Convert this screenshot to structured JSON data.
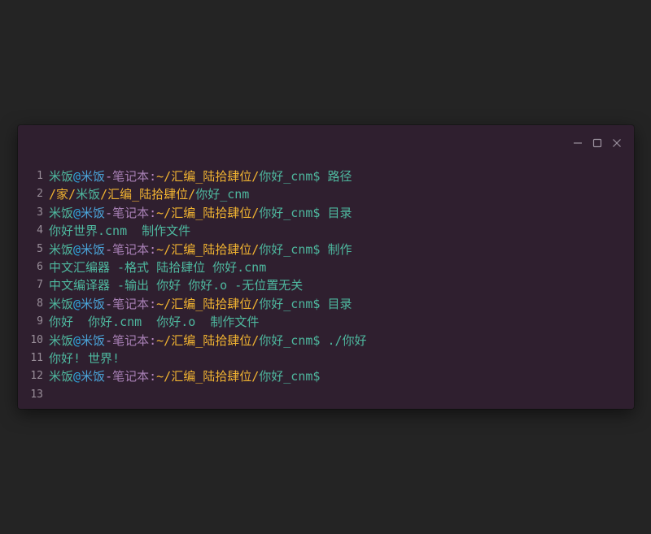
{
  "colors": {
    "background": "#242424",
    "window": "#2f1f2f",
    "user": "#4eb89f",
    "at": "#2fa7e0",
    "host": "#4aa3d8",
    "separator": "#b889c4",
    "path": "#f2b431",
    "output": "#4eb89f"
  },
  "window_controls": {
    "minimize_icon": "minimize-icon",
    "maximize_icon": "maximize-icon",
    "close_icon": "close-icon"
  },
  "prompt": {
    "user": "米饭",
    "at": "@",
    "host": "米饭",
    "dash": "-",
    "machine": "笔记本",
    "colon": ":",
    "home": "~",
    "slash": "/",
    "dir1": "汇编_陆拾肆位",
    "dir2": "你好_cnm",
    "dollar": "$"
  },
  "lines": [
    {
      "no": "1",
      "type": "prompt",
      "cmd": " 路径"
    },
    {
      "no": "2",
      "type": "path",
      "parts": [
        "/家/",
        "米饭",
        "/",
        "汇编_陆拾肆位",
        "/",
        "你好_cnm"
      ]
    },
    {
      "no": "3",
      "type": "prompt",
      "cmd": " 目录"
    },
    {
      "no": "4",
      "type": "output",
      "text": "你好世界.cnm  制作文件"
    },
    {
      "no": "5",
      "type": "prompt",
      "cmd": " 制作"
    },
    {
      "no": "6",
      "type": "output",
      "text": "中文汇编器 -格式 陆拾肆位 你好.cnm"
    },
    {
      "no": "7",
      "type": "output",
      "text": "中文编译器 -输出 你好 你好.o -无位置无关"
    },
    {
      "no": "8",
      "type": "prompt",
      "cmd": " 目录"
    },
    {
      "no": "9",
      "type": "output",
      "text": "你好  你好.cnm  你好.o  制作文件"
    },
    {
      "no": "10",
      "type": "prompt",
      "cmd": " ./你好"
    },
    {
      "no": "11",
      "type": "output",
      "text": "你好! 世界!"
    },
    {
      "no": "12",
      "type": "prompt",
      "cmd": ""
    },
    {
      "no": "13",
      "type": "empty",
      "text": ""
    }
  ]
}
